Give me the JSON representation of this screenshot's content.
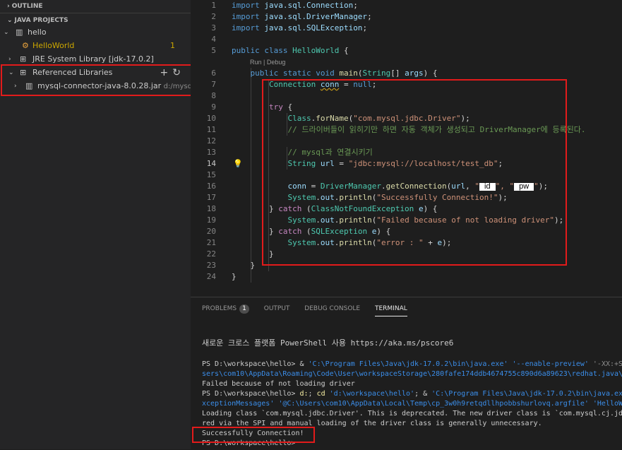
{
  "sidebar": {
    "outline_title": "OUTLINE",
    "projects_title": "JAVA PROJECTS",
    "items": [
      {
        "label": "hello",
        "icon": "project-icon"
      },
      {
        "label": "HelloWorld",
        "badge": "1",
        "icon": "java-class-icon"
      },
      {
        "label": "JRE System Library [jdk-17.0.2]",
        "icon": "library-icon"
      },
      {
        "label": "Referenced Libraries",
        "icon": "library-icon",
        "actions": [
          "+",
          "↻"
        ]
      },
      {
        "label": "mysql-connector-java-8.0.28.jar",
        "sub": "d:/mysql...",
        "icon": "jar-icon"
      }
    ]
  },
  "editor": {
    "active_line": "14",
    "codelens": "Run | Debug",
    "line_numbers": [
      "1",
      "2",
      "3",
      "4",
      "5",
      "6",
      "7",
      "8",
      "9",
      "10",
      "11",
      "12",
      "13",
      "14",
      "15",
      "16",
      "17",
      "18",
      "19",
      "20",
      "21",
      "22",
      "23",
      "24"
    ],
    "t": {
      "l1a": "import ",
      "l1b": "java.sql.Connection",
      "l2a": "import ",
      "l2b": "java.sql.DriverManager",
      "l3a": "import ",
      "l3b": "java.sql.SQLException",
      "l5a": "public ",
      "l5b": "class ",
      "l5c": "HelloWorld",
      "l6a": "public ",
      "l6b": "static ",
      "l6c": "void ",
      "l6d": "main",
      "l6e": "String",
      "l6f": "args",
      "l7a": "Connection ",
      "l7b": "conn",
      "l7c": " = ",
      "l7d": "null",
      "l9a": "try",
      "l10a": "Class",
      "l10b": "forName",
      "l10c": "\"com.mysql.jdbc.Driver\"",
      "l11": "// 드라이버들이 읽히기만 하면 자동 객체가 생성되고 DriverManager에 등록된다.",
      "l13": "// mysql과 연결시키기",
      "l14a": "String ",
      "l14b": "url",
      "l14c": " = ",
      "l14d": "\"jdbc:mysql://localhost/test_db\"",
      "l16a": "conn",
      "l16b": " = ",
      "l16c": "DriverManager",
      "l16d": "getConnection",
      "l16e": "url",
      "l16f": "\"",
      "l16g": "id",
      "l16h": "\", \"",
      "l16i": "pw",
      "l16j": "\"",
      "l17a": "System",
      "l17b": "out",
      "l17c": "println",
      "l17d": "\"Successfully Connection!\"",
      "l18a": "catch ",
      "l18b": "ClassNotFoundException ",
      "l18c": "e",
      "l19a": "System",
      "l19b": "out",
      "l19c": "println",
      "l19d": "\"Failed because of not loading driver\"",
      "l20a": "catch ",
      "l20b": "SQLException ",
      "l20c": "e",
      "l21a": "System",
      "l21b": "out",
      "l21c": "println",
      "l21d": "\"error : \"",
      "l21e": "e"
    }
  },
  "panel": {
    "tabs": {
      "problems": "PROBLEMS",
      "problems_badge": "1",
      "output": "OUTPUT",
      "debug": "DEBUG CONSOLE",
      "terminal": "TERMINAL"
    },
    "terminal": {
      "l1": "새로운 크로스 플랫폼 PowerShell 사용 https://aka.ms/pscore6",
      "l2a": "PS D:\\workspace\\hello> ",
      "l2b": "& ",
      "l2c": "'C:\\Program Files\\Java\\jdk-17.0.2\\bin\\java.exe' ",
      "l2d": "'--enable-preview' ",
      "l2e": "'-XX:+S",
      "l3": "sers\\com10\\AppData\\Roaming\\Code\\User\\workspaceStorage\\280fafe174ddb4674755c890d6a89623\\redhat.java\\j",
      "l4": "Failed because of not loading driver",
      "l5a": "PS D:\\workspace\\hello> ",
      "l5b": "d:",
      "l5c": "; ",
      "l5d": "cd ",
      "l5e": "'d:\\workspace\\hello'",
      "l5f": "; & ",
      "l5g": "'C:\\Program Files\\Java\\jdk-17.0.2\\bin\\java.ex",
      "l6": "xceptionMessages' '@C:\\Users\\com10\\AppData\\Local\\Temp\\cp_3w0h9retqdllhpobbshurlovq.argfile' 'HelloWo",
      "l7": "Loading class `com.mysql.jdbc.Driver'. This is deprecated. The new driver class is `com.mysql.cj.jdbc",
      "l8": "red via the SPI and manual loading of the driver class is generally unnecessary.",
      "l9": "Successfully Connection!",
      "l10": "PS D:\\workspace\\hello>"
    }
  },
  "colors": {
    "highlight_border": "#e21b1b",
    "background": "#1e1e1e",
    "sidebar": "#252526"
  }
}
